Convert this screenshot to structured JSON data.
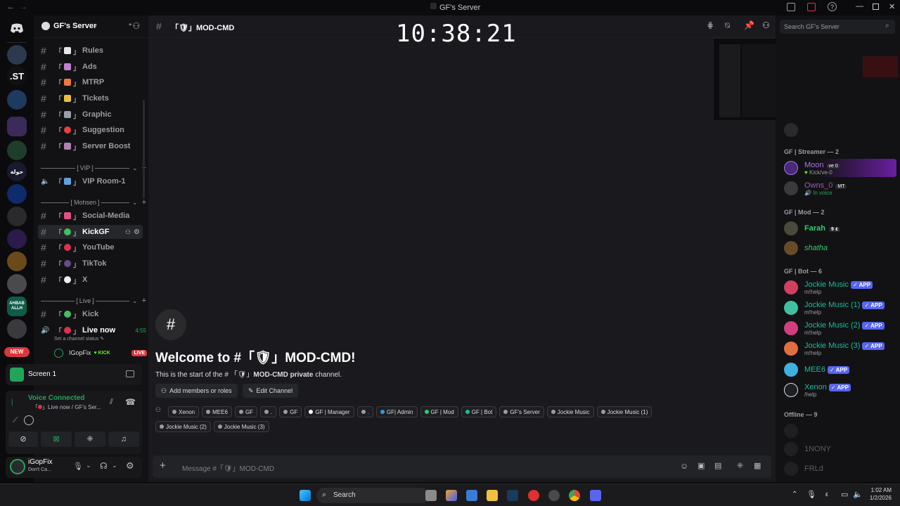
{
  "window": {
    "title": "GF's Server"
  },
  "clock": "10:38:21",
  "server": {
    "name": "GF's Server"
  },
  "rail": {
    "st": ".ST",
    "ahbab": "AHBAB ALLH",
    "new": "NEW"
  },
  "channels": {
    "rules": "Rules",
    "ads": "Ads",
    "mtrp": "MTRP",
    "tickets": "Tickets",
    "graphic": "Graphic",
    "suggestion": "Suggestion",
    "boost": "Server  Boost",
    "cat_vip": "VIP",
    "vip_room": "VIP Room-1",
    "cat_mohsen": "Mohsen",
    "social": "Social-Media",
    "kickgf": "KickGF",
    "youtube": "YouTube",
    "tiktok": "TikTok",
    "x": "X",
    "cat_live": "Live",
    "kick": "Kick",
    "live_now": "Live now",
    "live_time": "4:55",
    "channel_status": "Set a channel status",
    "voice_user": "IGopFix",
    "kick_badge": "KICK",
    "live_badge": "LIVE"
  },
  "stream": {
    "label": "Screen 1"
  },
  "voice": {
    "status": "Voice Connected",
    "where": "Live now / GF's Ser..."
  },
  "user": {
    "name": "iGopFix",
    "status": "Don't Ca..."
  },
  "header": {
    "channel": "「🛡」MOD-CMD",
    "search_placeholder": "Search GF's Server"
  },
  "welcome": {
    "title": "Welcome to #「🛡」MOD-CMD!",
    "desc_pre": "This is the start of the # 「🛡」",
    "desc_channel": "MOD-CMD private",
    "desc_post": " channel.",
    "add_members": "Add members or roles",
    "edit_channel": "Edit Channel"
  },
  "roles": [
    {
      "name": "Xenon",
      "color": "#9a9ca1"
    },
    {
      "name": "MEE6",
      "color": "#9a9ca1"
    },
    {
      "name": "GF",
      "color": "#9a9ca1"
    },
    {
      "name": ".",
      "color": "#9a9ca1"
    },
    {
      "name": "GF",
      "color": "#9a9ca1"
    },
    {
      "name": "GF | Manager",
      "color": "#ffffff"
    },
    {
      "name": ".",
      "color": "#9a9ca1"
    },
    {
      "name": "GF| Admin",
      "color": "#3498db"
    },
    {
      "name": "GF | Mod",
      "color": "#2ecc71"
    },
    {
      "name": "GF | Bot",
      "color": "#1abc9c"
    },
    {
      "name": "GF's Server",
      "color": "#9a9ca1"
    },
    {
      "name": "Jockie Music",
      "color": "#9a9ca1"
    },
    {
      "name": "Jockie Music (1)",
      "color": "#9a9ca1"
    },
    {
      "name": "Jockie Music (2)",
      "color": "#9a9ca1"
    },
    {
      "name": "Jockie Music (3)",
      "color": "#9a9ca1"
    }
  ],
  "composer": {
    "placeholder": "Message #「🛡」MOD-CMD"
  },
  "members": {
    "streamer_head": "GF | Streamer — 2",
    "moon": "Moon",
    "moon_tag": "ve 0",
    "moon_sub": "Kick/ve-0",
    "owns": "Owns_0",
    "owns_tag": "MT",
    "owns_sub": "In voice",
    "mod_head": "GF | Mod — 2",
    "farah": "Farah",
    "farah_tag": "9 ٤",
    "shatha": "shatha",
    "bot_head": "GF | Bot — 6",
    "jm0": "Jockie Music",
    "jm1": "Jockie Music (1)",
    "jm2": "Jockie Music (2)",
    "jm3": "Jockie Music (3)",
    "mhelp": "m!help",
    "mee6": "MEE6",
    "xenon": "Xenon",
    "xhelp": "/help",
    "app": "APP",
    "offline_head": "Offline — 9",
    "off1": "1NONY",
    "off2": "FRLd"
  },
  "taskbar": {
    "search": "Search",
    "time": "1:02 AM",
    "date": "1/2/2026"
  }
}
